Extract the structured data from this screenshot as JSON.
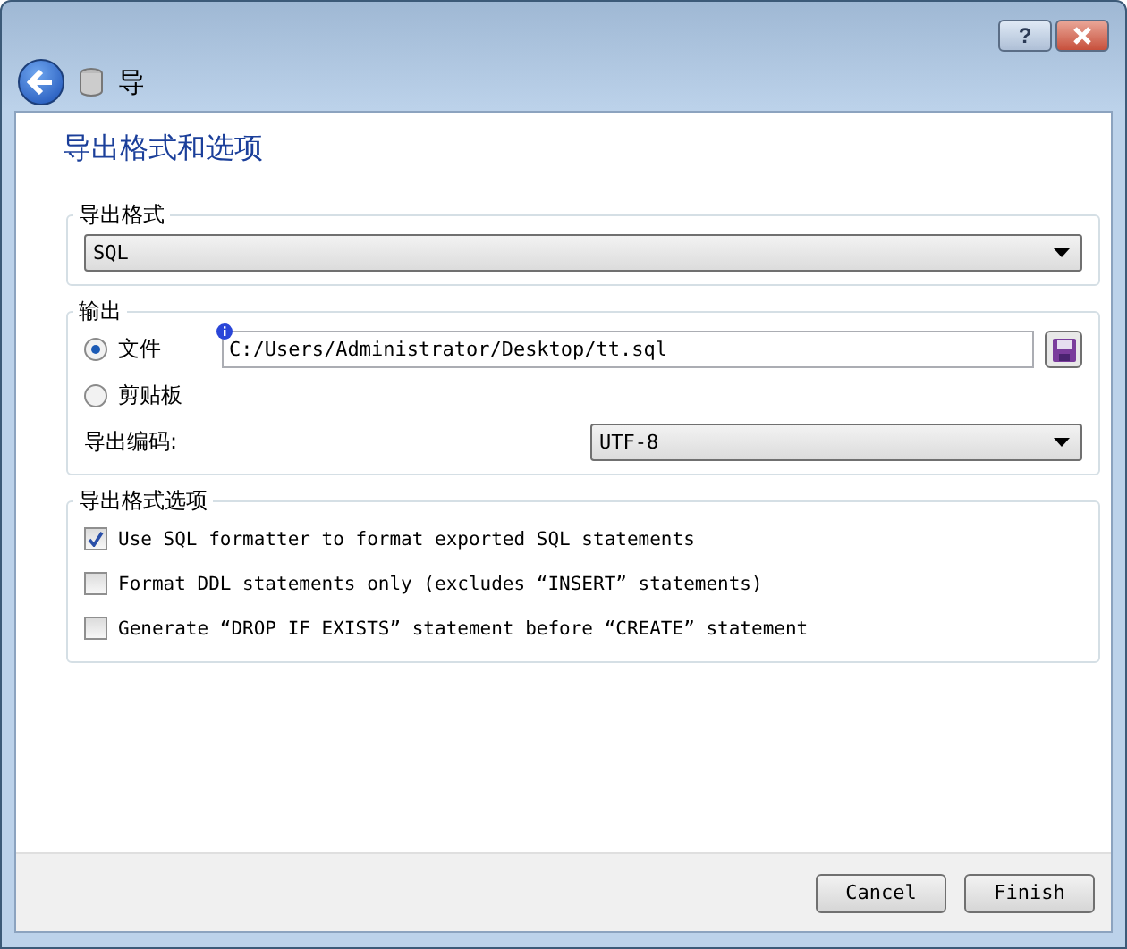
{
  "window": {
    "help_button": "?",
    "title": "导"
  },
  "heading": "导出格式和选项",
  "format_group": {
    "legend": "导出格式",
    "value": "SQL"
  },
  "output_group": {
    "legend": "输出",
    "targets": [
      {
        "label": "文件",
        "selected": true
      },
      {
        "label": "剪贴板",
        "selected": false
      }
    ],
    "file_path": "C:/Users/Administrator/Desktop/tt.sql",
    "encoding_label": "导出编码:",
    "encoding": "UTF-8"
  },
  "options_group": {
    "legend": "导出格式选项",
    "options": [
      {
        "label": "Use SQL formatter to format exported SQL statements",
        "checked": true
      },
      {
        "label": "Format DDL statements only (excludes “INSERT” statements)",
        "checked": false
      },
      {
        "label": "Generate “DROP IF EXISTS” statement before “CREATE” statement",
        "checked": false
      }
    ]
  },
  "buttons": [
    "Cancel",
    "Finish"
  ]
}
